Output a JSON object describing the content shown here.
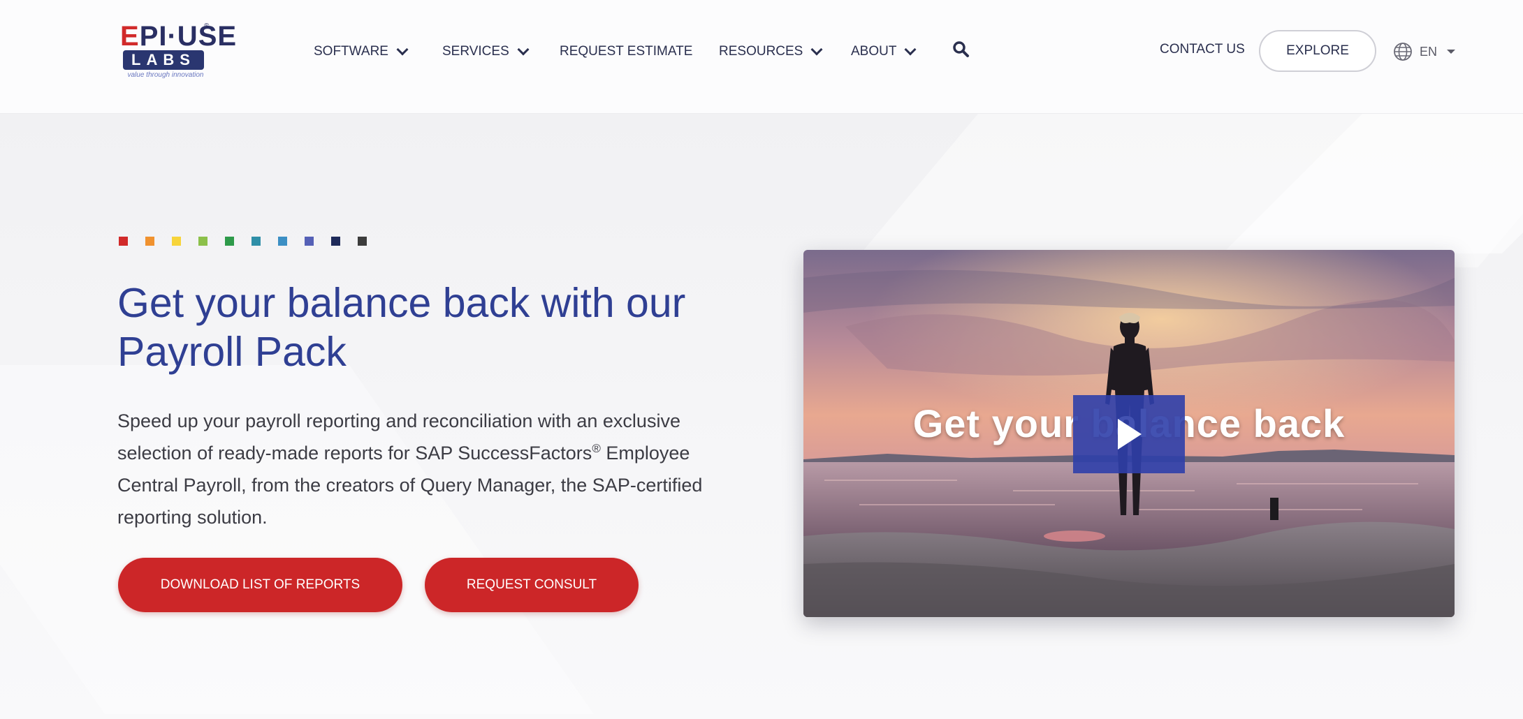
{
  "brand": {
    "logo_mark": "EPI·USE",
    "logo_sub": "LABS",
    "tagline": "value through innovation"
  },
  "nav": {
    "items": [
      {
        "label": "SOFTWARE",
        "dropdown": true
      },
      {
        "label": "SERVICES",
        "dropdown": true
      },
      {
        "label": "REQUEST ESTIMATE",
        "dropdown": false
      },
      {
        "label": "RESOURCES",
        "dropdown": true
      },
      {
        "label": "ABOUT",
        "dropdown": true
      }
    ],
    "search_icon": "search-icon",
    "contact": "CONTACT US",
    "explore": "EXPLORE",
    "language": "EN",
    "language_icon": "globe-icon"
  },
  "hero": {
    "accent_dots": [
      "#d12a2a",
      "#f0922f",
      "#f7d43a",
      "#8cc04a",
      "#2e9a4a",
      "#2f8fa8",
      "#3c8fc4",
      "#5560b6",
      "#1e2a5a",
      "#3c3c3c"
    ],
    "headline": "Get your balance back with our Payroll Pack",
    "body_pre": "Speed up your payroll reporting and reconciliation with an exclusive selection of ready-made reports for SAP SuccessFactors",
    "body_sup": "®",
    "body_post": " Employee Central Payroll, from the creators of Query Manager, the SAP-certified reporting solution.",
    "cta_primary": "DOWNLOAD LIST OF REPORTS",
    "cta_secondary": "REQUEST CONSULT"
  },
  "video": {
    "title": "Get your balance back",
    "play_icon": "play-icon"
  },
  "colors": {
    "brand_blue": "#2f3f93",
    "brand_red": "#cc2628",
    "nav_text": "#2a2f4e"
  }
}
